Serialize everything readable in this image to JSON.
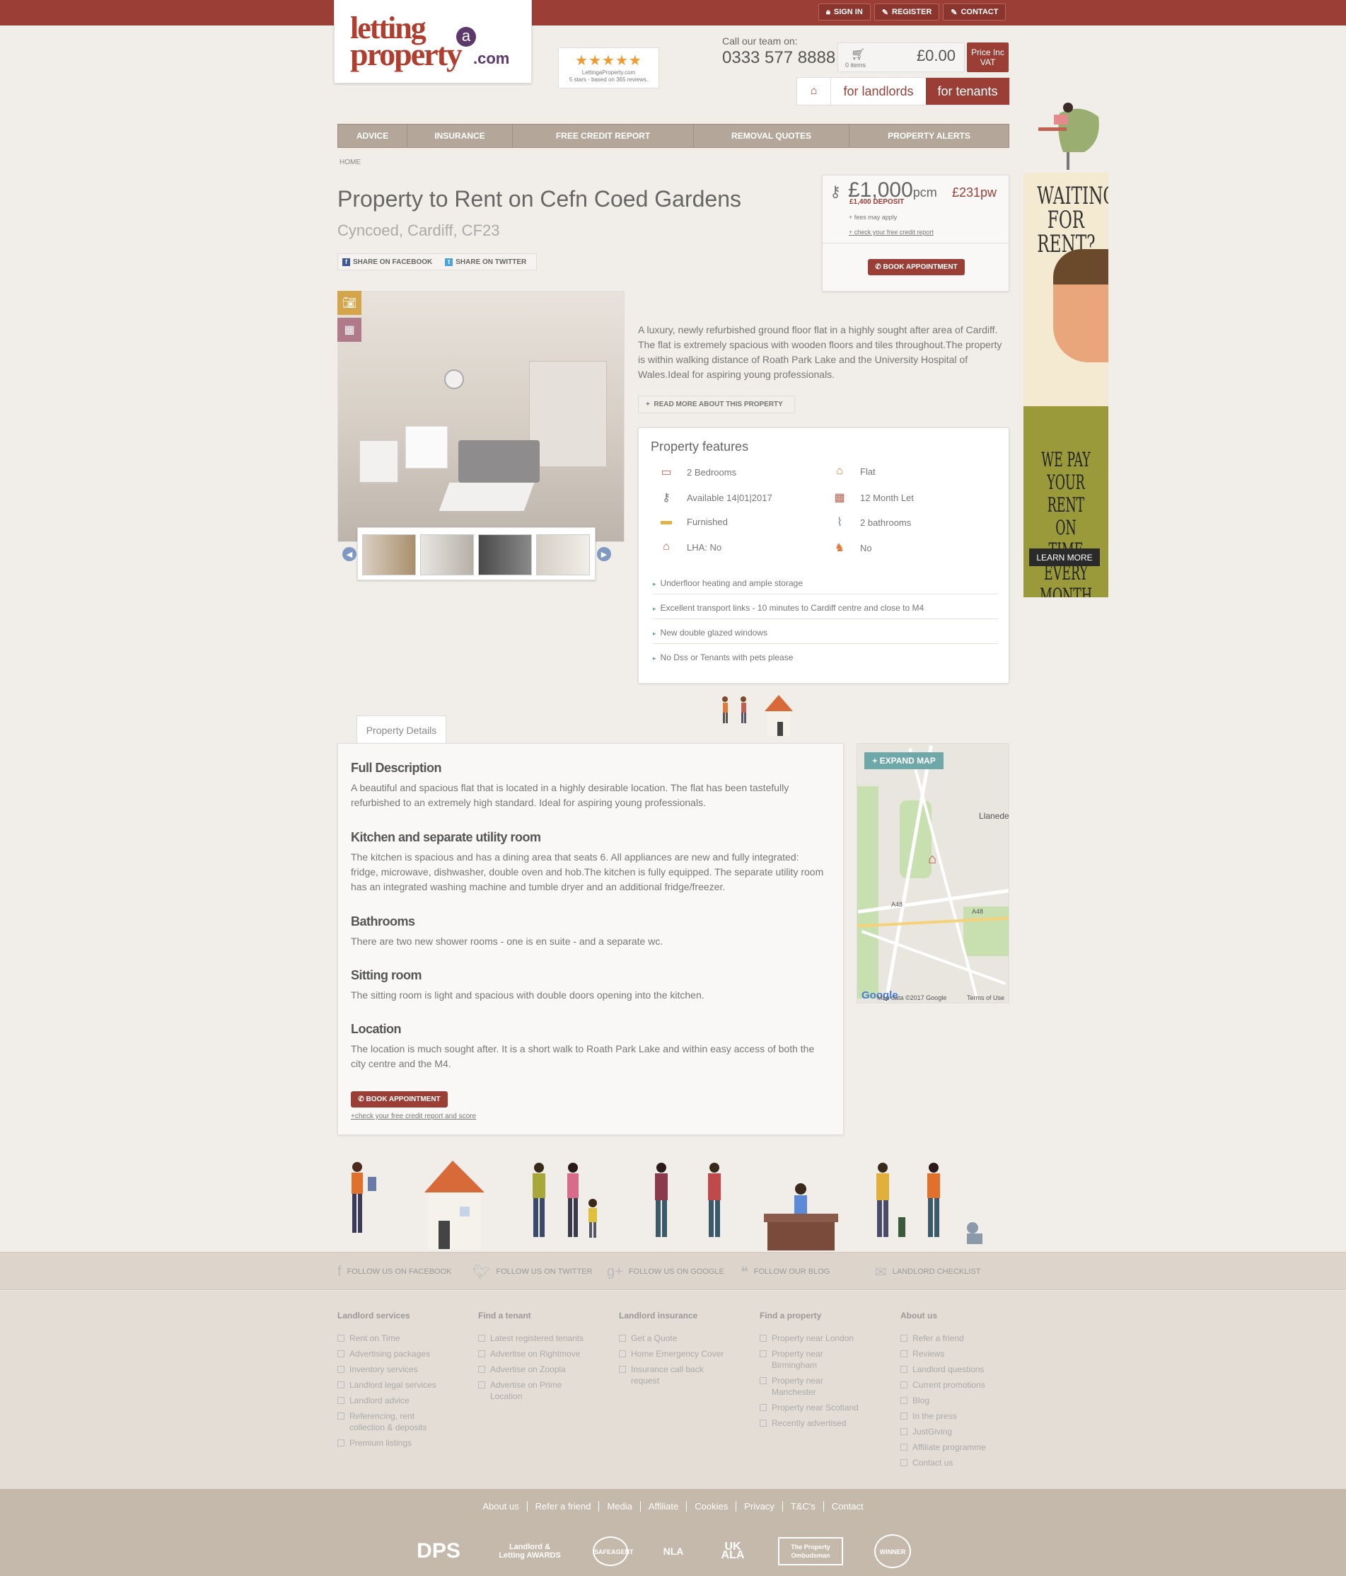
{
  "header": {
    "top_buttons": [
      "SIGN IN",
      "REGISTER",
      "CONTACT"
    ],
    "logo": {
      "line1": "letting",
      "a": "a",
      "line2": "property",
      "tld": ".com"
    },
    "rating": {
      "stars": "★★★★★",
      "site": "LettingaProperty.com",
      "text": "5 stars - based on 365 reviews."
    },
    "call_label": "Call our team on:",
    "phone": "0333 577 8888",
    "basket": {
      "items": "0 items",
      "amount": "£0.00"
    },
    "vat": "Price Inc VAT",
    "audience": {
      "landlords": "for landlords",
      "tenants": "for tenants"
    }
  },
  "nav": [
    "ADVICE",
    "INSURANCE",
    "FREE CREDIT REPORT",
    "REMOVAL QUOTES",
    "PROPERTY ALERTS"
  ],
  "breadcrumb": "HOME",
  "property": {
    "title": "Property to Rent on Cefn Coed Gardens",
    "location": "Cyncoed, Cardiff, CF23",
    "share_facebook": "SHARE ON FACEBOOK",
    "share_twitter": "SHARE ON TWITTER",
    "description": "A luxury, newly refurbished ground floor flat in a highly sought after area of Cardiff. The flat is extremely spacious with wooden floors and tiles throughout.The property is within walking distance of Roath Park Lake and the University Hospital of Wales.Ideal for aspiring young professionals.",
    "read_more": "READ MORE ABOUT THIS PROPERTY"
  },
  "price": {
    "pcm": "£1,000",
    "pcm_unit": "pcm",
    "pw": "£231pw",
    "deposit": "£1,400 DEPOSIT",
    "fees": "fees may apply",
    "credit": "check your free credit report",
    "book": "BOOK APPOINTMENT"
  },
  "features": {
    "title": "Property features",
    "items": [
      {
        "icon": "bed-icon",
        "text": "2 Bedrooms"
      },
      {
        "icon": "house-icon",
        "text": "Flat"
      },
      {
        "icon": "key-icon",
        "text": "Available 14|01|2017"
      },
      {
        "icon": "calendar-icon",
        "text": "12 Month Let"
      },
      {
        "icon": "sofa-icon",
        "text": "Furnished"
      },
      {
        "icon": "shower-icon",
        "text": "2 bathrooms"
      },
      {
        "icon": "lha-icon",
        "text": "LHA: No"
      },
      {
        "icon": "dog-icon",
        "text": "No"
      }
    ],
    "bullets": [
      "Underfloor heating and ample storage",
      "Excellent transport links - 10 minutes to Cardiff centre and close to M4",
      "New double glazed windows",
      "No Dss or Tenants with pets please"
    ]
  },
  "details": {
    "tab": "Property Details",
    "sections": [
      {
        "h": "Full Description",
        "p": "A beautiful and spacious flat that is located in a highly desirable location. The flat has been tastefully refurbished to an extremely high standard. Ideal for aspiring young professionals."
      },
      {
        "h": "Kitchen and separate utility room",
        "p": "The kitchen is spacious and has a dining area that seats 6. All appliances are new and fully integrated: fridge, microwave, dishwasher, double oven and hob.The kitchen is fully equipped. The separate utility room has an integrated washing machine and tumble dryer and an additional fridge/freezer."
      },
      {
        "h": "Bathrooms",
        "p": "There are two new shower rooms - one is en suite - and a separate wc."
      },
      {
        "h": "Sitting room",
        "p": "The sitting room is light and spacious with double doors opening into the kitchen."
      },
      {
        "h": "Location",
        "p": "The location is much sought after. It is a short walk to Roath Park Lake and within easy access of both the city centre and the M4."
      }
    ],
    "book": "BOOK APPOINTMENT",
    "credit": "check your free credit report and score"
  },
  "map": {
    "expand": "EXPAND MAP",
    "labels": {
      "llanede": "Llanede",
      "a48a": "A48",
      "a48b": "A48"
    },
    "copyright": "Map data ©2017 Google",
    "terms": "Terms of Use",
    "google": "Google"
  },
  "ad": {
    "headline": "WAITING FOR RENT?",
    "tagline": "WE PAY YOUR RENT ON TIME EVERY MONTH",
    "cta": "LEARN MORE"
  },
  "social": [
    "FOLLOW US ON FACEBOOK",
    "FOLLOW US ON TWITTER",
    "FOLLOW US ON GOOGLE",
    "FOLLOW OUR BLOG",
    "LANDLORD CHECKLIST"
  ],
  "footer": {
    "columns": [
      {
        "title": "Landlord services",
        "links": [
          "Rent on Time",
          "Advertising packages",
          "Inventory services",
          "Landlord legal services",
          "Landlord advice",
          "Referencing, rent collection & deposits",
          "Premium listings"
        ]
      },
      {
        "title": "Find a tenant",
        "links": [
          "Latest registered tenants",
          "Advertise on Rightmove",
          "Advertise on Zoopla",
          "Advertise on Prime Location"
        ]
      },
      {
        "title": "Landlord insurance",
        "links": [
          "Get a Quote",
          "Home Emergency Cover",
          "Insurance call back request"
        ]
      },
      {
        "title": "Find a property",
        "links": [
          "Property near London",
          "Property near Birmingham",
          "Property near Manchester",
          "Property near Scotland",
          "Recently advertised"
        ]
      },
      {
        "title": "About us",
        "links": [
          "Refer a friend",
          "Reviews",
          "Landlord questions",
          "Current promotions",
          "Blog",
          "In the press",
          "JustGiving",
          "Affiliate programme",
          "Contact us"
        ]
      }
    ],
    "bottom_links": [
      "About us",
      "Refer a friend",
      "Media",
      "Affiliate",
      "Cookies",
      "Privacy",
      "T&C's",
      "Contact"
    ],
    "logos": [
      "DPS",
      "Landlord & Letting AWARDS",
      "SAFEAGENT",
      "NLA",
      "UK ALA",
      "The Property Ombudsman",
      "WINNER"
    ]
  }
}
